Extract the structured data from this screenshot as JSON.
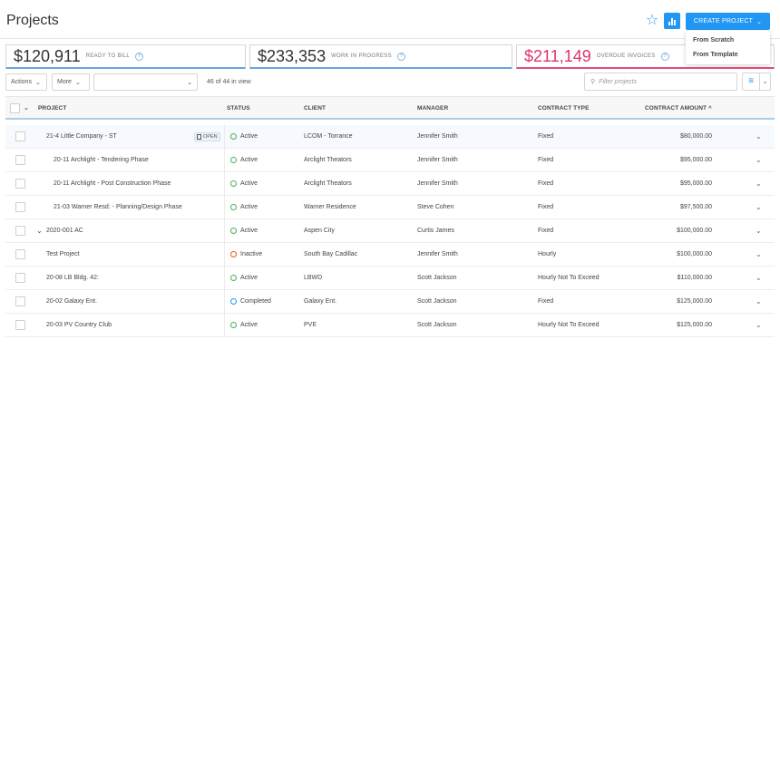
{
  "header": {
    "title": "Projects",
    "star_icon": "star-icon",
    "chart_icon": "bar-chart-icon",
    "create_label": "CREATE PROJECT",
    "accent": "#2196f3"
  },
  "create_menu": {
    "items": [
      "From Scratch",
      "From Template"
    ]
  },
  "summary_cards": [
    {
      "amount": "$120,911",
      "label": "READY TO BILL"
    },
    {
      "amount": "$233,353",
      "label": "WORK IN PROGRESS"
    },
    {
      "amount": "$211,149",
      "label": "OVERDUE INVOICES",
      "color": "#e0336d"
    }
  ],
  "toolbar": {
    "actions_label": "Actions",
    "more_label": "More",
    "view_select_value": "",
    "in_view": "46 of 44 in view",
    "filter_placeholder": "Filter projects"
  },
  "table": {
    "columns": [
      "PROJECT",
      "STATUS",
      "CLIENT",
      "MANAGER",
      "CONTRACT TYPE",
      "CONTRACT AMOUNT"
    ],
    "sort_indicator": "^",
    "open_badge": "OPEN",
    "rows": [
      {
        "project": "21-4 Little Company - ST",
        "status": "Active",
        "client": "LCOM - Torrance",
        "manager": "Jennifer Smith",
        "type": "Fixed",
        "amount": "$80,000.00"
      },
      {
        "project": "20-11 Archlight - Tendering Phase",
        "status": "Active",
        "client": "Arclight Theators",
        "manager": "Jennifer Smith",
        "type": "Fixed",
        "amount": "$95,000.00"
      },
      {
        "project": "20-11 Archlight - Post Construction Phase",
        "status": "Active",
        "client": "Arclight Theators",
        "manager": "Jennifer Smith",
        "type": "Fixed",
        "amount": "$95,000.00"
      },
      {
        "project": "21-03 Warner Resd: - Planning/Design Phase",
        "status": "Active",
        "client": "Warner Residence",
        "manager": "Steve Cohen",
        "type": "Fixed",
        "amount": "$97,500.00"
      },
      {
        "project": "2020-001 AC",
        "status": "Active",
        "client": "Aspen City",
        "manager": "Curtis James",
        "type": "Fixed",
        "amount": "$100,000.00"
      },
      {
        "project": "Test Project",
        "status": "Inactive",
        "client": "South Bay Cadillac",
        "manager": "Jennifer Smith",
        "type": "Hourly",
        "amount": "$100,000.00"
      },
      {
        "project": "20-08 LB Bldg. 42:",
        "status": "Active",
        "client": "LBWD",
        "manager": "Scott Jackson",
        "type": "Hourly Not To Exceed",
        "amount": "$110,000.00"
      },
      {
        "project": "20-02 Galaxy Ent.",
        "status": "Completed",
        "client": "Galaxy Ent.",
        "manager": "Scott Jackson",
        "type": "Fixed",
        "amount": "$125,000.00"
      },
      {
        "project": "20-03 PV Country Club",
        "status": "Active",
        "client": "PVE",
        "manager": "Scott Jackson",
        "type": "Hourly Not To Exceed",
        "amount": "$125,000.00"
      }
    ],
    "status_colors": {
      "Active": "#4caf50",
      "Inactive": "#f4511e",
      "Completed": "#2196f3"
    }
  }
}
